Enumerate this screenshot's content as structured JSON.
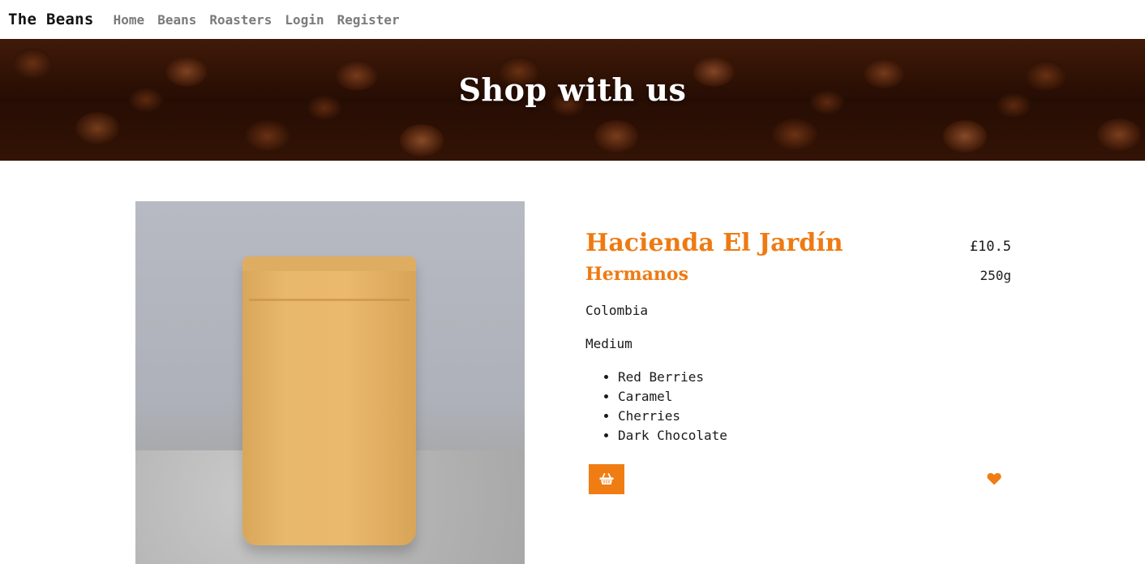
{
  "navbar": {
    "brand": "The Beans",
    "links": [
      "Home",
      "Beans",
      "Roasters",
      "Login",
      "Register"
    ]
  },
  "hero": {
    "title": "Shop with us"
  },
  "product": {
    "name": "Hacienda El Jardín",
    "price": "£10.5",
    "roaster": "Hermanos",
    "weight": "250g",
    "origin": "Colombia",
    "roast": "Medium",
    "tasting_notes": [
      "Red Berries",
      "Caramel",
      "Cherries",
      "Dark Chocolate"
    ]
  },
  "icons": {
    "basket": "shopping-basket-icon",
    "favourite": "heart-icon"
  },
  "colors": {
    "accent": "#ef7d14",
    "nav_text": "#7b7b7b"
  }
}
